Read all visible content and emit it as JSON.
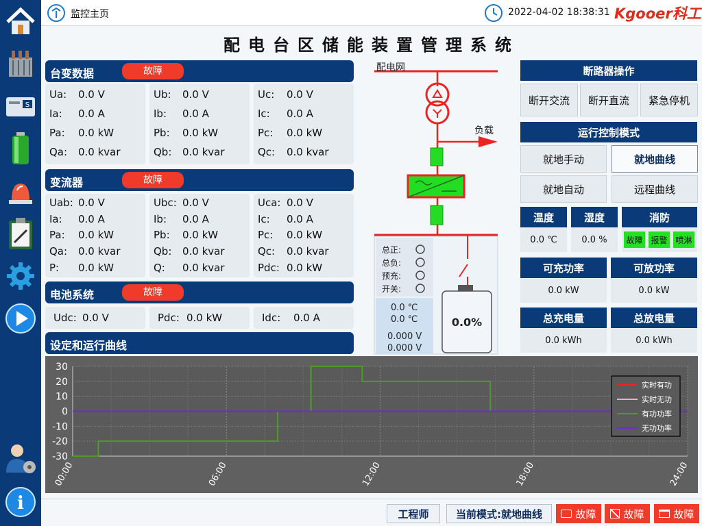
{
  "header": {
    "home_label": "监控主页",
    "datetime": "2022-04-02 18:38:31",
    "logo_text": "Kgooer科工"
  },
  "title": "配电台区储能装置管理系统",
  "transformer": {
    "title": "台变数据",
    "status": "故障",
    "cols": [
      [
        {
          "k": "Ua:",
          "v": "0.0 V"
        },
        {
          "k": "Ia:",
          "v": "0.0 A"
        },
        {
          "k": "Pa:",
          "v": "0.0 kW"
        },
        {
          "k": "Qa:",
          "v": "0.0 kvar"
        }
      ],
      [
        {
          "k": "Ub:",
          "v": "0.0 V"
        },
        {
          "k": "Ib:",
          "v": "0.0 A"
        },
        {
          "k": "Pb:",
          "v": "0.0 kW"
        },
        {
          "k": "Qb:",
          "v": "0.0 kvar"
        }
      ],
      [
        {
          "k": "Uc:",
          "v": "0.0 V"
        },
        {
          "k": "Ic:",
          "v": "0.0 A"
        },
        {
          "k": "Pc:",
          "v": "0.0 kW"
        },
        {
          "k": "Qc:",
          "v": "0.0 kvar"
        }
      ]
    ]
  },
  "converter": {
    "title": "变流器",
    "status": "故障",
    "cols": [
      [
        {
          "k": "Uab:",
          "v": "0.0 V"
        },
        {
          "k": "Ia:",
          "v": "0.0 A"
        },
        {
          "k": "Pa:",
          "v": "0.0 kW"
        },
        {
          "k": "Qa:",
          "v": "0.0 kvar"
        },
        {
          "k": "P:",
          "v": "0.0 kW"
        }
      ],
      [
        {
          "k": "Ubc:",
          "v": "0.0 V"
        },
        {
          "k": "Ib:",
          "v": "0.0 A"
        },
        {
          "k": "Pb:",
          "v": "0.0 kW"
        },
        {
          "k": "Qb:",
          "v": "0.0 kvar"
        },
        {
          "k": "Q:",
          "v": "0.0 kvar"
        }
      ],
      [
        {
          "k": "Uca:",
          "v": "0.0 V"
        },
        {
          "k": "Ic:",
          "v": "0.0 A"
        },
        {
          "k": "Pc:",
          "v": "0.0 kW"
        },
        {
          "k": "Qc:",
          "v": "0.0 kvar"
        },
        {
          "k": "Pdc:",
          "v": "0.0 kW"
        }
      ]
    ]
  },
  "battery": {
    "title": "电池系统",
    "status": "故障",
    "items": [
      {
        "k": "Udc:",
        "v": "0.0 V"
      },
      {
        "k": "Pdc:",
        "v": "0.0 kW"
      },
      {
        "k": "Idc:",
        "v": "0.0 A"
      }
    ]
  },
  "curve_section_title": "设定和运行曲线",
  "diagram": {
    "grid_label": "配电网",
    "load_label": "负载",
    "bus_labels": [
      "总正:",
      "总负:",
      "预充:",
      "开关:"
    ],
    "temps": [
      "0.0 ℃",
      "0.0 ℃"
    ],
    "volts": [
      "0.000 V",
      "0.000 V"
    ],
    "soc": "0.0%",
    "colors": {
      "line": "#ee2222",
      "module": "#22dd22"
    }
  },
  "breaker": {
    "title": "断路器操作",
    "buttons": [
      "断开交流",
      "断开直流",
      "紧急停机"
    ]
  },
  "mode": {
    "title": "运行控制模式",
    "buttons": [
      "就地手动",
      "就地曲线",
      "就地自动",
      "远程曲线"
    ],
    "active": "就地曲线"
  },
  "env": {
    "temp_label": "温度",
    "temp_value": "0.0 ℃",
    "hum_label": "湿度",
    "hum_value": "0.0 %",
    "fire_label": "消防",
    "fire_buttons": [
      "故障",
      "报警",
      "喷淋"
    ]
  },
  "power": {
    "charge_label": "可充功率",
    "charge_value": "0.0 kW",
    "discharge_label": "可放功率",
    "discharge_value": "0.0 kW"
  },
  "energy": {
    "charge_label": "总充电量",
    "charge_value": "0.0 kWh",
    "discharge_label": "总放电量",
    "discharge_value": "0.0 kWh"
  },
  "chart_data": {
    "type": "line",
    "ylim": [
      -30,
      30
    ],
    "yticks": [
      30,
      20,
      10,
      0,
      -10,
      -20,
      -30
    ],
    "xlim": [
      0,
      24
    ],
    "xticks": [
      {
        "v": 0,
        "label": "00:00"
      },
      {
        "v": 6,
        "label": "06:00"
      },
      {
        "v": 12,
        "label": "12:00"
      },
      {
        "v": 18,
        "label": "18:00"
      },
      {
        "v": 24,
        "label": "24:00"
      }
    ],
    "legend": [
      {
        "name": "实时有功",
        "color": "#ee2222"
      },
      {
        "name": "实时无功",
        "color": "#ffaacc"
      },
      {
        "name": "有功功率",
        "color": "#4e9a2a"
      },
      {
        "name": "无功功率",
        "color": "#7a22dd"
      }
    ],
    "series": [
      {
        "name": "有功功率",
        "color": "#4e9a2a",
        "points": [
          [
            0,
            -30
          ],
          [
            1,
            -30
          ],
          [
            1,
            -20
          ],
          [
            8,
            -20
          ],
          [
            8,
            0
          ],
          [
            9.3,
            0
          ],
          [
            9.3,
            30
          ],
          [
            11.3,
            30
          ],
          [
            11.3,
            20
          ],
          [
            16.3,
            20
          ],
          [
            16.3,
            0
          ],
          [
            24,
            0
          ]
        ]
      },
      {
        "name": "无功功率",
        "color": "#7a22dd",
        "points": [
          [
            0,
            0
          ],
          [
            24,
            0
          ]
        ]
      }
    ]
  },
  "footer": {
    "user_role": "工程师",
    "mode_text": "当前模式:就地曲线",
    "fault_labels": [
      "故障",
      "故障",
      "故障"
    ]
  }
}
